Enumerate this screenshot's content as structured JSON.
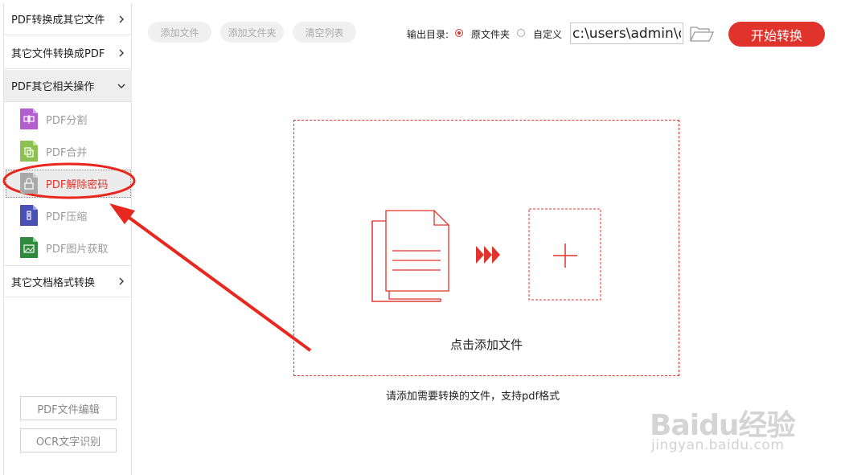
{
  "sidebar": {
    "sections": [
      {
        "label": "PDF转换成其它文件"
      },
      {
        "label": "其它文件转换成PDF"
      },
      {
        "label": "PDF其它相关操作"
      },
      {
        "label": "其它文档格式转换"
      }
    ],
    "sub_items": [
      {
        "label": "PDF分割",
        "icon": "split-file-icon",
        "color": "#b45fd0"
      },
      {
        "label": "PDF合并",
        "icon": "merge-file-icon",
        "color": "#8cc152"
      },
      {
        "label": "PDF解除密码",
        "icon": "unlock-file-icon",
        "color": "#999999",
        "active": true
      },
      {
        "label": "PDF压缩",
        "icon": "compress-file-icon",
        "color": "#4a4fb5"
      },
      {
        "label": "PDF图片获取",
        "icon": "image-file-icon",
        "color": "#2e8b3e"
      }
    ],
    "tools": [
      {
        "label": "PDF文件编辑"
      },
      {
        "label": "OCR文字识别"
      }
    ]
  },
  "toolbar": {
    "add_file": "添加文件",
    "add_folder": "添加文件夹",
    "clear_list": "清空列表",
    "output_dir_label": "输出目录:",
    "option_original": "原文件夹",
    "option_custom": "自定义",
    "path_value": "c:\\users\\admin\\d",
    "start": "开始转换"
  },
  "dropzone": {
    "text": "点击添加文件",
    "hint": "请添加需要转换的文件，支持pdf格式"
  },
  "watermark": {
    "logo": "Baidu经验",
    "url": "jingyan.baidu.com"
  },
  "colors": {
    "accent": "#e0332b",
    "annotation": "#e8271e"
  }
}
